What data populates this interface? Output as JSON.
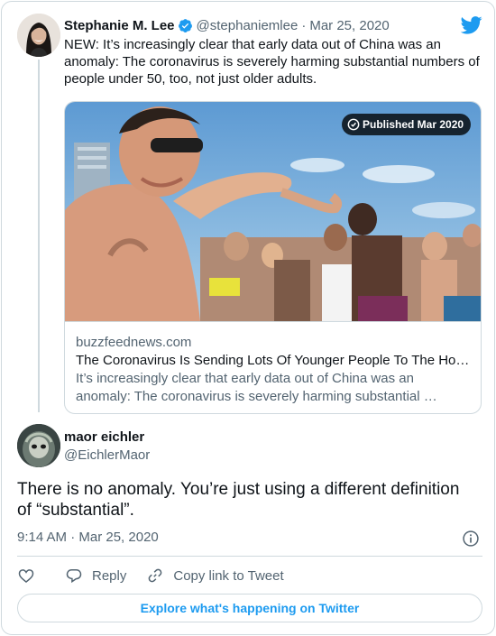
{
  "parent_tweet": {
    "display_name": "Stephanie M. Lee",
    "handle": "@stephaniemlee",
    "separator": "·",
    "date": "Mar 25, 2020",
    "text": "NEW: It’s increasingly clear that early data out of China was an anomaly: The coronavirus is severely harming substantial numbers of people under 50, too, not just older adults.",
    "link_card": {
      "badge": "Published Mar 2020",
      "domain": "buzzfeednews.com",
      "title": "The Coronavirus Is Sending Lots Of Younger People To The Ho…",
      "description": "It’s increasingly clear that early data out of China was an anomaly: The coronavirus is severely harming substantial …"
    }
  },
  "reply_tweet": {
    "display_name": "maor eichler",
    "handle": "@EichlerMaor",
    "text": "There is no anomaly. You’re just using a different definition of “substantial”.",
    "timestamp": "9:14 AM · Mar 25, 2020"
  },
  "actions": {
    "reply_label": "Reply",
    "copy_link_label": "Copy link to Tweet"
  },
  "explore_label": "Explore what's happening on Twitter",
  "icons": {
    "verified": "verified-badge-icon",
    "twitter": "twitter-bird-icon",
    "info": "info-icon",
    "like": "heart-icon",
    "reply": "speech-bubble-icon",
    "copy_link": "link-icon",
    "published": "clock-icon"
  },
  "colors": {
    "accent": "#1d9bf0",
    "text": "#0f1419",
    "secondary_text": "#536471",
    "border": "#cfd9de"
  }
}
